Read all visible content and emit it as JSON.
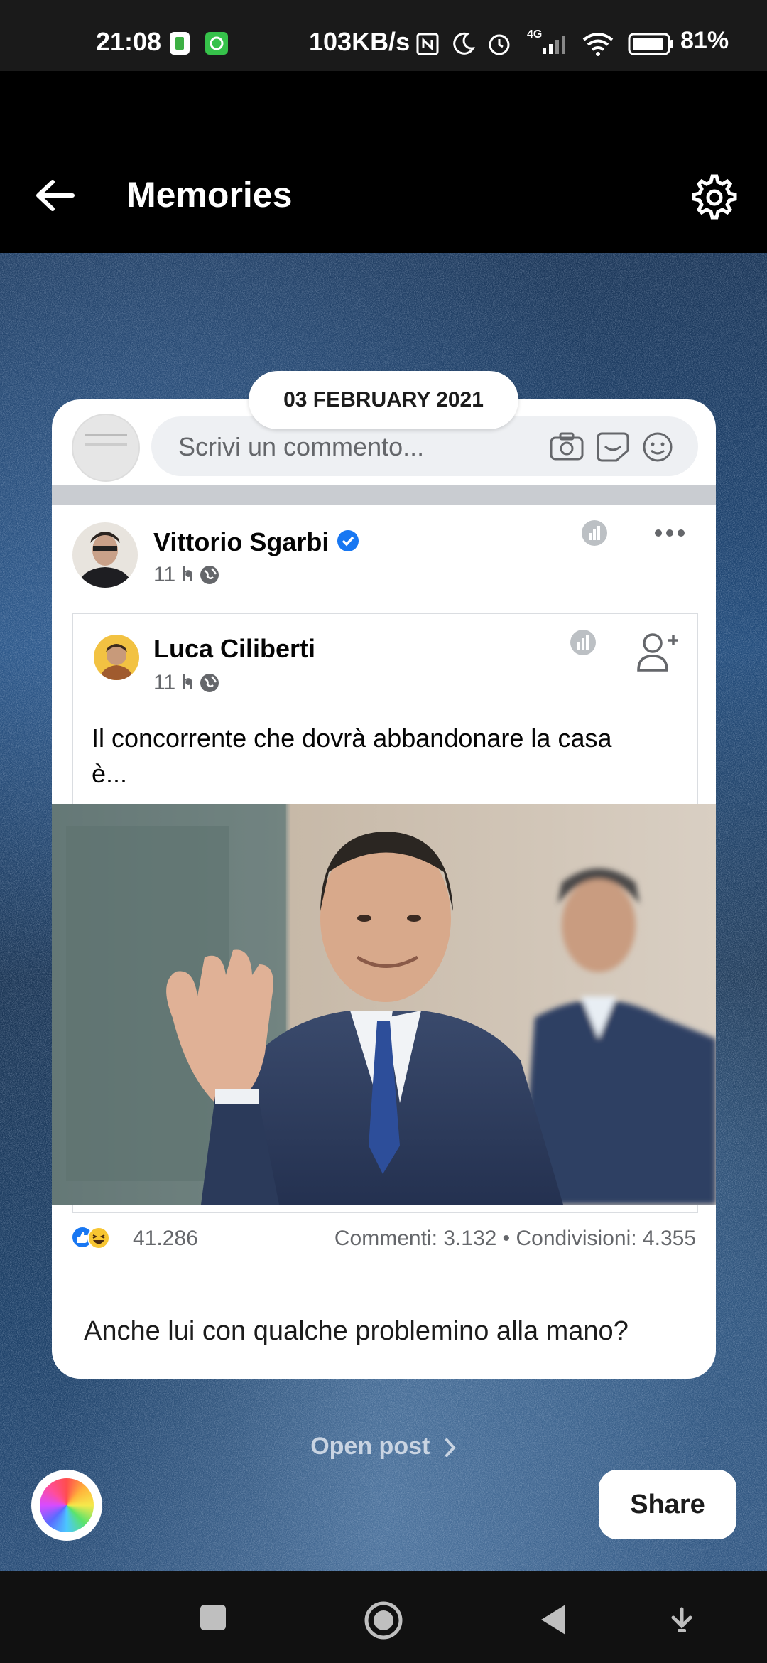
{
  "status_bar": {
    "time": "21:08",
    "network_speed": "103KB/s",
    "signal_label": "4G",
    "battery_percent": "81%"
  },
  "header": {
    "title": "Memories",
    "back_icon": "arrow-left-icon",
    "settings_icon": "gear-icon"
  },
  "memory": {
    "date": "03 FEBRUARY 2021",
    "comment_placeholder": "Scrivi un commento...",
    "author": {
      "name": "Vittorio Sgarbi",
      "time": "11 h",
      "verified": true
    },
    "shared_post": {
      "name": "Luca Ciliberti",
      "time": "11 h",
      "text_line1": "Il concorrente che dovrà abbandonare la casa",
      "text_line2": "è..."
    },
    "reactions_count": "41.286",
    "comments_shares": "Commenti: 3.132 • Condivisioni: 4.355",
    "caption": "Anche lui con qualche problemino alla mano?"
  },
  "actions": {
    "open_post": "Open post",
    "share": "Share"
  },
  "colors": {
    "accent_blue": "#1877f2",
    "card_bg": "#ffffff",
    "header_bg": "#000000"
  }
}
